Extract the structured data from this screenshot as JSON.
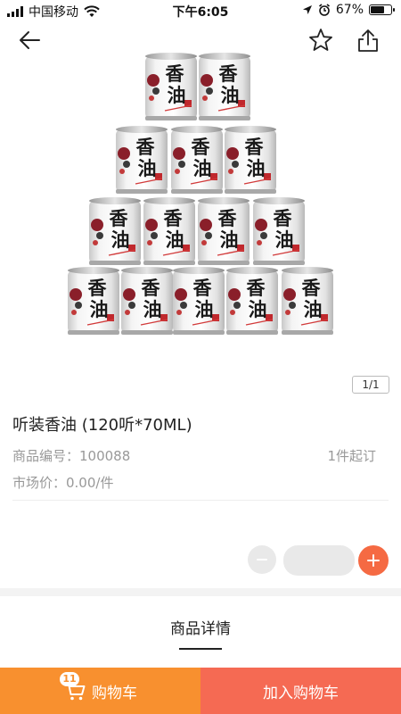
{
  "status_bar": {
    "carrier": "中国移动",
    "time": "下午6:05",
    "battery": "67%",
    "battery_level": 0.67
  },
  "nav": {
    "back_icon": "back-arrow-icon",
    "favorite_icon": "star-icon",
    "share_icon": "share-icon"
  },
  "product": {
    "image_counter": "1/1",
    "title": "听装香油 (120听*70ML)",
    "sku_label": "商品编号：100088",
    "min_order": "1件起订",
    "price_label": "市场价：0.00/件",
    "can_label": "香油"
  },
  "quantity": {
    "value": "",
    "minus_icon": "minus-icon",
    "plus_icon": "plus-icon"
  },
  "tabs": {
    "detail": "商品详情"
  },
  "bottom_bar": {
    "cart_label": "购物车",
    "cart_count": "11",
    "add_to_cart_label": "加入购物车"
  },
  "colors": {
    "accent_orange": "#f8902f",
    "accent_red": "#f56a53",
    "plus_button": "#f56a43"
  }
}
